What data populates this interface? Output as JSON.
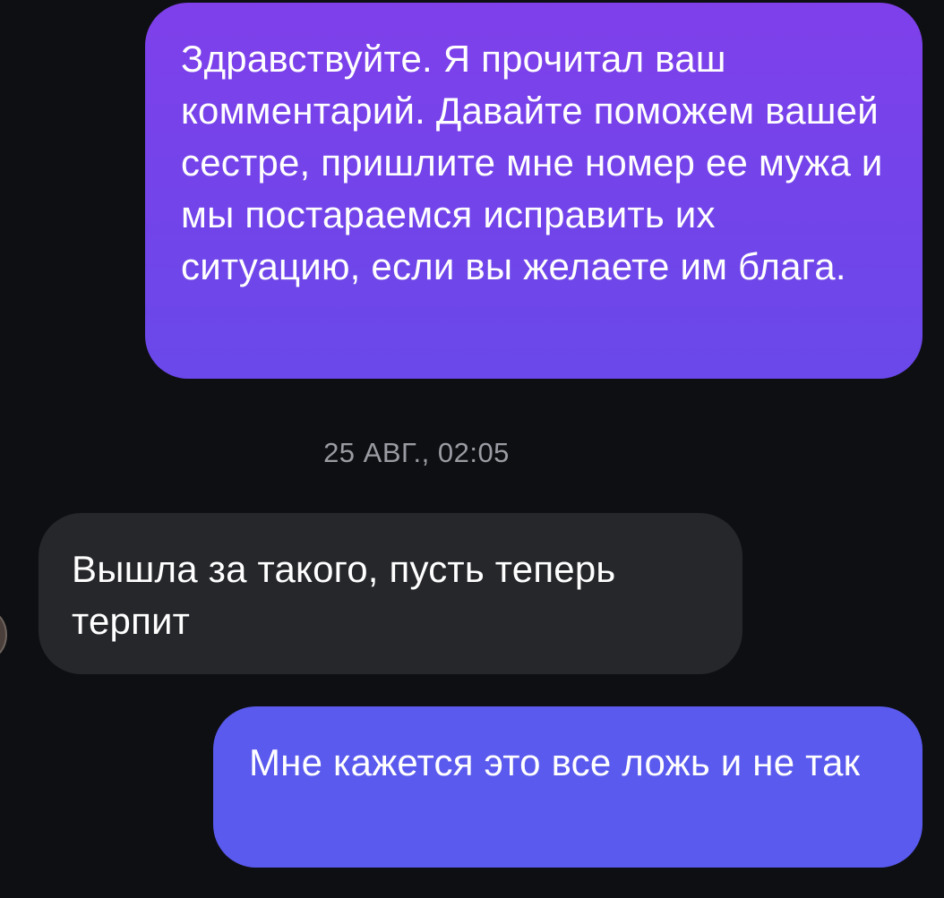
{
  "conversation": {
    "messages": [
      {
        "direction": "outgoing",
        "text": "Здравствуйте. Я прочитал ваш комментарий. Давайте поможем вашей сестре, пришлите мне номер ее мужа и мы постараемся исправить их ситуацию, если вы желаете им блага."
      },
      {
        "direction": "incoming",
        "text": "Вышла за такого, пусть теперь терпит"
      },
      {
        "direction": "outgoing",
        "text": "Мне кажется это все ложь и не так"
      }
    ],
    "timestamp": "25 АВГ., 02:05"
  },
  "colors": {
    "background": "#0e0f12",
    "outgoing_bubble_top": "#7f40ea",
    "outgoing_bubble_bottom": "#5a5aee",
    "incoming_bubble": "#25272b",
    "timestamp_text": "#9b9ca3"
  }
}
